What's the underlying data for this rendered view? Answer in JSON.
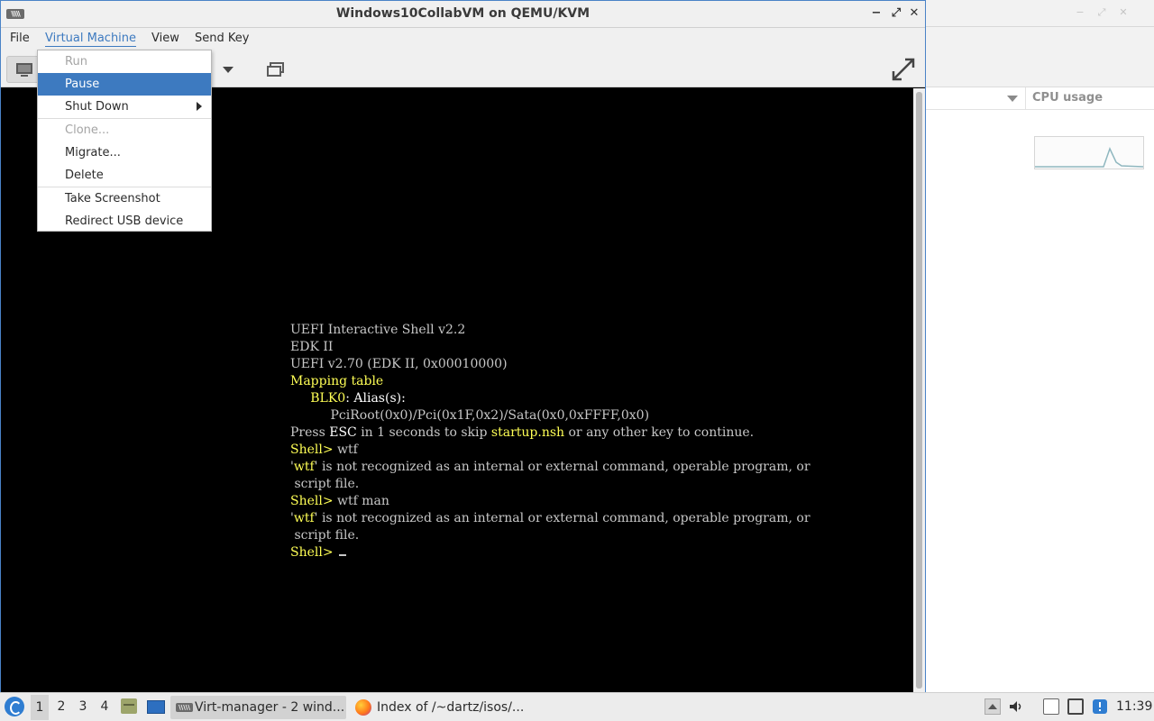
{
  "window": {
    "title": "Windows10CollabVM on QEMU/KVM",
    "app_icon_text": "\\\\\\\\\\",
    "minimize": "−",
    "maximize": "⤢",
    "close": "✕"
  },
  "menubar": {
    "items": [
      "File",
      "Virtual Machine",
      "View",
      "Send Key"
    ],
    "active": "Virtual Machine"
  },
  "vm_menu": {
    "items": [
      {
        "label": "Run",
        "state": "disabled"
      },
      {
        "label": "Pause",
        "state": "highlighted"
      },
      {
        "label": "Shut Down",
        "state": "submenu"
      },
      {
        "label": "Clone...",
        "state": "disabled"
      },
      {
        "label": "Migrate...",
        "state": "enabled"
      },
      {
        "label": "Delete",
        "state": "enabled"
      },
      {
        "label": "Take Screenshot",
        "state": "enabled"
      },
      {
        "label": "Redirect USB device",
        "state": "enabled"
      }
    ]
  },
  "background_window": {
    "column_header": "CPU usage"
  },
  "terminal": {
    "lines": [
      [
        {
          "t": "UEFI Interactive Shell v2.2",
          "c": "g"
        }
      ],
      [
        {
          "t": "EDK II",
          "c": "g"
        }
      ],
      [
        {
          "t": "UEFI v2.70 (EDK II, 0x00010000)",
          "c": "g"
        }
      ],
      [
        {
          "t": "Mapping table",
          "c": "y"
        }
      ],
      [
        {
          "t": "     ",
          "c": "g"
        },
        {
          "t": "BLK0",
          "c": "y"
        },
        {
          "t": ": Alias(s):",
          "c": "w"
        }
      ],
      [
        {
          "t": "          PciRoot(0x0)/Pci(0x1F,0x2)/Sata(0x0,0xFFFF,0x0)",
          "c": "g"
        }
      ],
      [
        {
          "t": "Press ",
          "c": "g"
        },
        {
          "t": "ESC",
          "c": "w"
        },
        {
          "t": " in 1 seconds to skip ",
          "c": "g"
        },
        {
          "t": "startup.nsh",
          "c": "y"
        },
        {
          "t": " or any other key to continue.",
          "c": "g"
        }
      ],
      [
        {
          "t": "Shell>",
          "c": "y"
        },
        {
          "t": " wtf",
          "c": "g"
        }
      ],
      [
        {
          "t": "'",
          "c": "g"
        },
        {
          "t": "wtf",
          "c": "y"
        },
        {
          "t": "' is not recognized as an internal or external command, operable program, or",
          "c": "g"
        }
      ],
      [
        {
          "t": " script file.",
          "c": "g"
        }
      ],
      [
        {
          "t": "Shell>",
          "c": "y"
        },
        {
          "t": " wtf man",
          "c": "g"
        }
      ],
      [
        {
          "t": "'",
          "c": "g"
        },
        {
          "t": "wtf",
          "c": "y"
        },
        {
          "t": "' is not recognized as an internal or external command, operable program, or",
          "c": "g"
        }
      ],
      [
        {
          "t": " script file.",
          "c": "g"
        }
      ],
      [
        {
          "t": "Shell>",
          "c": "y"
        },
        {
          "t": " ",
          "c": "g"
        }
      ]
    ]
  },
  "colors": {
    "terminal_yellow": "#ffff55",
    "terminal_white": "#ffffff",
    "terminal_gray": "#c7c7c7",
    "menu_highlight": "#3d7ac0"
  },
  "taskbar": {
    "workspaces": [
      "1",
      "2",
      "3",
      "4"
    ],
    "active_workspace": "1",
    "tasks": [
      {
        "label": "Virt-manager - 2 wind...",
        "icon": "virt-manager-icon",
        "active": true
      },
      {
        "label": "Index of /~dartz/isos/...",
        "icon": "firefox-icon",
        "active": false
      }
    ],
    "clock": "11:39"
  }
}
